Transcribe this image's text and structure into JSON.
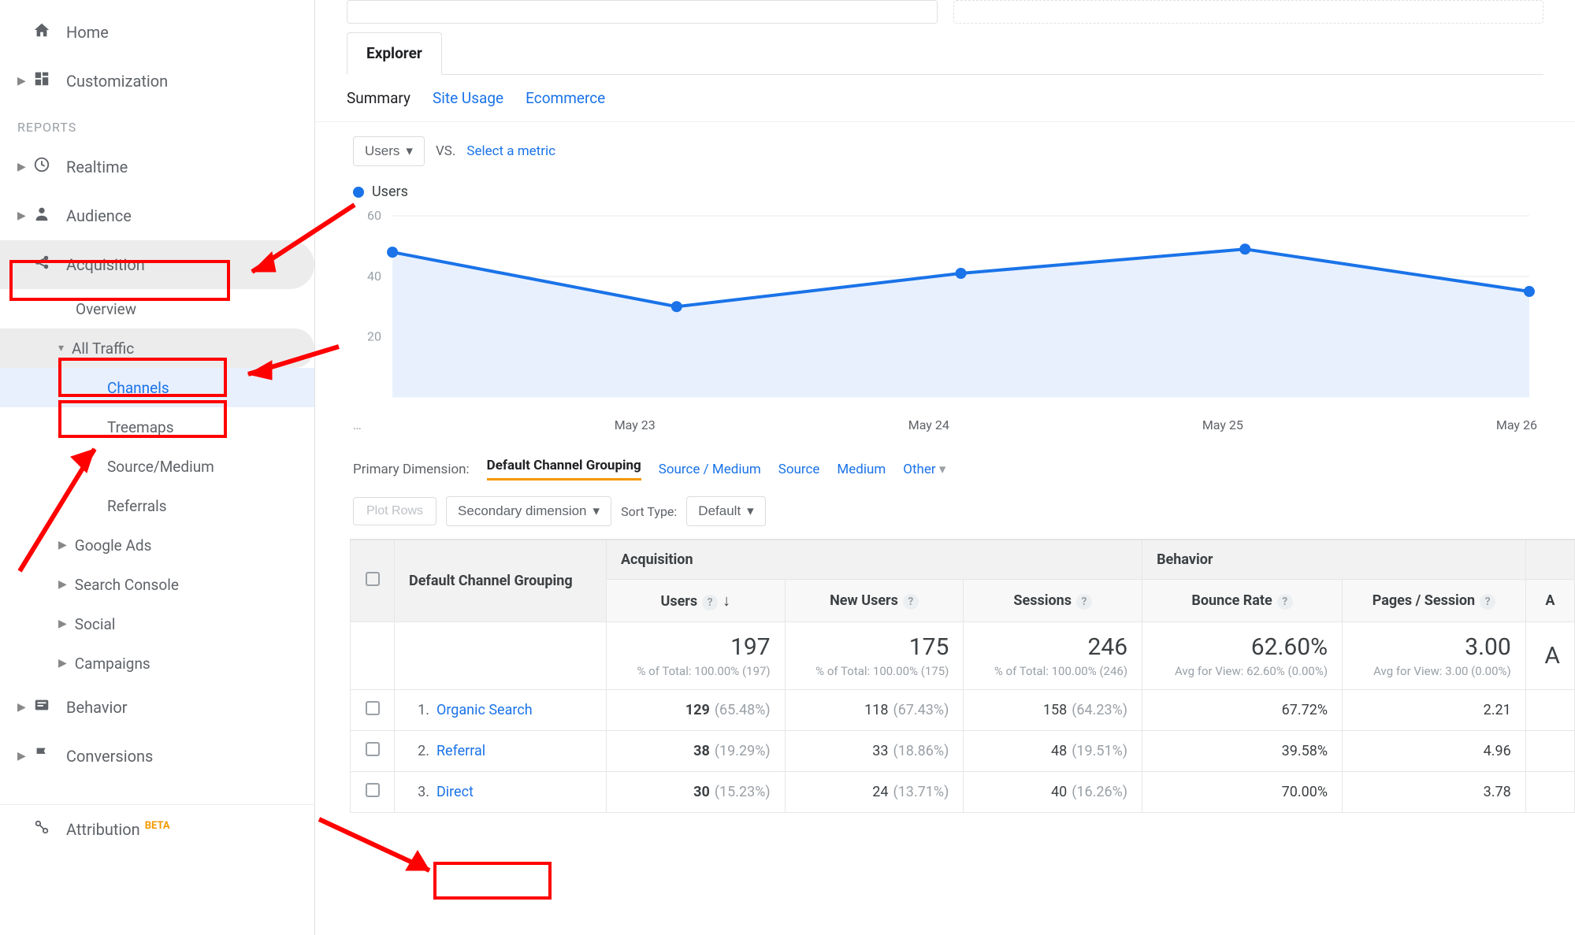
{
  "sidebar": {
    "home": "Home",
    "customization": "Customization",
    "reports_label": "REPORTS",
    "realtime": "Realtime",
    "audience": "Audience",
    "acquisition": "Acquisition",
    "acq_overview": "Overview",
    "acq_alltraffic": "All Traffic",
    "acq_channels": "Channels",
    "acq_treemaps": "Treemaps",
    "acq_sourcemedium": "Source/Medium",
    "acq_referrals": "Referrals",
    "acq_googleads": "Google Ads",
    "acq_searchconsole": "Search Console",
    "acq_social": "Social",
    "acq_campaigns": "Campaigns",
    "behavior": "Behavior",
    "conversions": "Conversions",
    "attribution": "Attribution",
    "attribution_badge": "BETA"
  },
  "tabs": {
    "explorer": "Explorer"
  },
  "subtabs": {
    "summary": "Summary",
    "siteusage": "Site Usage",
    "ecommerce": "Ecommerce"
  },
  "controls": {
    "metric1": "Users",
    "vs": "VS.",
    "select_metric": "Select a metric"
  },
  "legend": {
    "series1": "Users"
  },
  "chart_data": {
    "type": "line",
    "series": [
      {
        "name": "Users",
        "color": "#1a73e8",
        "values": [
          48,
          30,
          41,
          49,
          35
        ]
      }
    ],
    "categories": [
      "…",
      "May 23",
      "May 24",
      "May 25",
      "May 26"
    ],
    "ylim": [
      0,
      60
    ],
    "yticks": [
      20,
      40,
      60
    ]
  },
  "dimensions": {
    "label": "Primary Dimension:",
    "active": "Default Channel Grouping",
    "source_medium": "Source / Medium",
    "source": "Source",
    "medium": "Medium",
    "other": "Other"
  },
  "tools": {
    "plot_rows": "Plot Rows",
    "secondary_dim": "Secondary dimension",
    "sort_type_lbl": "Sort Type:",
    "sort_type_val": "Default"
  },
  "table": {
    "col_dim": "Default Channel Grouping",
    "group_acq": "Acquisition",
    "group_behavior": "Behavior",
    "col_users": "Users",
    "col_newusers": "New Users",
    "col_sessions": "Sessions",
    "col_bounce": "Bounce Rate",
    "col_pages": "Pages / Session",
    "col_avg_partial": "A",
    "totals": {
      "users": "197",
      "users_sub": "% of Total: 100.00% (197)",
      "newusers": "175",
      "newusers_sub": "% of Total: 100.00% (175)",
      "sessions": "246",
      "sessions_sub": "% of Total: 100.00% (246)",
      "bounce": "62.60%",
      "bounce_sub": "Avg for View: 62.60% (0.00%)",
      "pages": "3.00",
      "pages_sub": "Avg for View: 3.00 (0.00%)",
      "avg_partial": "A"
    },
    "rows": [
      {
        "n": "1.",
        "name": "Organic Search",
        "users": "129",
        "users_pct": "(65.48%)",
        "newusers": "118",
        "newusers_pct": "(67.43%)",
        "sessions": "158",
        "sessions_pct": "(64.23%)",
        "bounce": "67.72%",
        "pages": "2.21"
      },
      {
        "n": "2.",
        "name": "Referral",
        "users": "38",
        "users_pct": "(19.29%)",
        "newusers": "33",
        "newusers_pct": "(18.86%)",
        "sessions": "48",
        "sessions_pct": "(19.51%)",
        "bounce": "39.58%",
        "pages": "4.96"
      },
      {
        "n": "3.",
        "name": "Direct",
        "users": "30",
        "users_pct": "(15.23%)",
        "newusers": "24",
        "newusers_pct": "(13.71%)",
        "sessions": "40",
        "sessions_pct": "(16.26%)",
        "bounce": "70.00%",
        "pages": "3.78"
      }
    ]
  }
}
